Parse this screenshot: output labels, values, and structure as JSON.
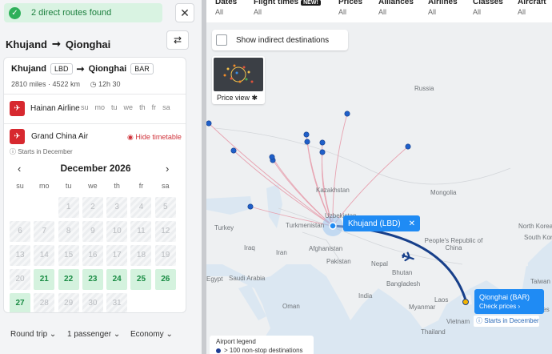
{
  "toast": {
    "text": "2 direct routes found",
    "icon": "check-icon"
  },
  "header": {
    "from": "Khujand",
    "to": "Qionghai",
    "arrow": "➞",
    "swap_icon": "swap-icon"
  },
  "route_card": {
    "from_city": "Khujand",
    "from_code": "LBD",
    "to_city": "Qionghai",
    "to_code": "BAR",
    "distance": "2810 miles · 4522 km",
    "duration": "12h 30"
  },
  "airlines": [
    {
      "name": "Hainan Airline",
      "days": [
        "su",
        "mo",
        "tu",
        "we",
        "th",
        "fr",
        "sa"
      ]
    },
    {
      "name": "Grand China Air",
      "hide_label": "Hide timetable",
      "starts": "Starts in December"
    }
  ],
  "calendar": {
    "month": "December 2026",
    "day_headers": [
      "su",
      "mo",
      "tu",
      "we",
      "th",
      "fr",
      "sa"
    ],
    "cells": [
      {
        "d": "",
        "s": "blank"
      },
      {
        "d": "",
        "s": "blank"
      },
      {
        "d": "1",
        "s": "off"
      },
      {
        "d": "2",
        "s": "off"
      },
      {
        "d": "3",
        "s": "off"
      },
      {
        "d": "4",
        "s": "off"
      },
      {
        "d": "5",
        "s": "off"
      },
      {
        "d": "6",
        "s": "off"
      },
      {
        "d": "7",
        "s": "off"
      },
      {
        "d": "8",
        "s": "off"
      },
      {
        "d": "9",
        "s": "off"
      },
      {
        "d": "10",
        "s": "off"
      },
      {
        "d": "11",
        "s": "off"
      },
      {
        "d": "12",
        "s": "off"
      },
      {
        "d": "13",
        "s": "off"
      },
      {
        "d": "14",
        "s": "off"
      },
      {
        "d": "15",
        "s": "off"
      },
      {
        "d": "16",
        "s": "off"
      },
      {
        "d": "17",
        "s": "off"
      },
      {
        "d": "18",
        "s": "off"
      },
      {
        "d": "19",
        "s": "off"
      },
      {
        "d": "20",
        "s": "off"
      },
      {
        "d": "21",
        "s": "on"
      },
      {
        "d": "22",
        "s": "on"
      },
      {
        "d": "23",
        "s": "on"
      },
      {
        "d": "24",
        "s": "on"
      },
      {
        "d": "25",
        "s": "on"
      },
      {
        "d": "26",
        "s": "on"
      },
      {
        "d": "27",
        "s": "on"
      },
      {
        "d": "28",
        "s": "off"
      },
      {
        "d": "29",
        "s": "off"
      },
      {
        "d": "30",
        "s": "off"
      },
      {
        "d": "31",
        "s": "off"
      },
      {
        "d": "",
        "s": "blank"
      },
      {
        "d": "",
        "s": "blank"
      }
    ]
  },
  "bottom_bar": {
    "trip": "Round trip",
    "passengers": "1 passenger",
    "cabin": "Economy"
  },
  "filters": [
    {
      "label": "Dates",
      "value": "All"
    },
    {
      "label": "Flight times",
      "value": "All",
      "badge": "NEW!"
    },
    {
      "label": "Prices",
      "value": "All"
    },
    {
      "label": "Alliances",
      "value": "All"
    },
    {
      "label": "Airlines",
      "value": "All"
    },
    {
      "label": "Classes",
      "value": "All"
    },
    {
      "label": "Aircraft",
      "value": "All"
    }
  ],
  "map": {
    "indirect_label": "Show indirect destinations",
    "price_view": "Price view",
    "origin_label": "Khujand (LBD)",
    "dest_label": "Qionghai (BAR)",
    "dest_action": "Check prices",
    "dest_starts": "Starts in December",
    "legend_title": "Airport legend",
    "legend_item": "> 100 non-stop destinations",
    "places": [
      "Russia",
      "Kazakhstan",
      "Mongolia",
      "Uzbekistan",
      "Turkmenistan",
      "Turkey",
      "Iran",
      "Iraq",
      "Afghanistan",
      "Pakistan",
      "Nepal",
      "Bhutan",
      "India",
      "Bangladesh",
      "Saudi Arabia",
      "Egypt",
      "Oman",
      "Myanmar",
      "Laos",
      "Thailand",
      "Vietnam",
      "People's Republic of China",
      "North Korea",
      "South Korea",
      "Taiwan",
      "Philippines"
    ],
    "accent": "#1f8bf4",
    "route_color": "#173f8a"
  }
}
